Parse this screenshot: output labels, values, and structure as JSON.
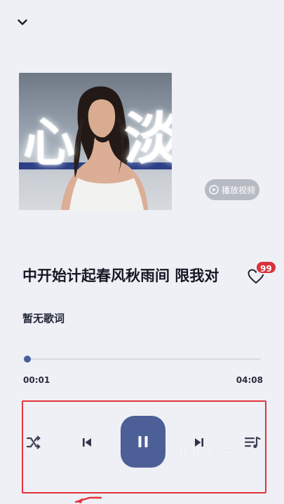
{
  "header": {
    "collapse_icon": "chevron-down-icon"
  },
  "cover": {
    "overlay_text": [
      "心",
      "淡"
    ]
  },
  "video_button": {
    "icon": "play-circle-icon",
    "label": "播放视频"
  },
  "song": {
    "title": "中开始计起春风秋雨间 限我对",
    "favorite_icon": "heart-outline-icon",
    "favorite_count": "99"
  },
  "lyrics": {
    "placeholder": "暂无歌词"
  },
  "playback": {
    "elapsed": "00:01",
    "total": "04:08",
    "progress_fraction": 0.004
  },
  "controls": {
    "shuffle_icon": "shuffle-icon",
    "previous_icon": "skip-previous-icon",
    "play_pause_icon": "pause-icon",
    "next_icon": "skip-next-icon",
    "queue_icon": "playlist-icon"
  },
  "watermark": "4k4k手游网",
  "colors": {
    "background": "#eef0f6",
    "accent": "#4c5f97",
    "badge": "#d8323a",
    "highlight_frame": "#e3343b"
  }
}
